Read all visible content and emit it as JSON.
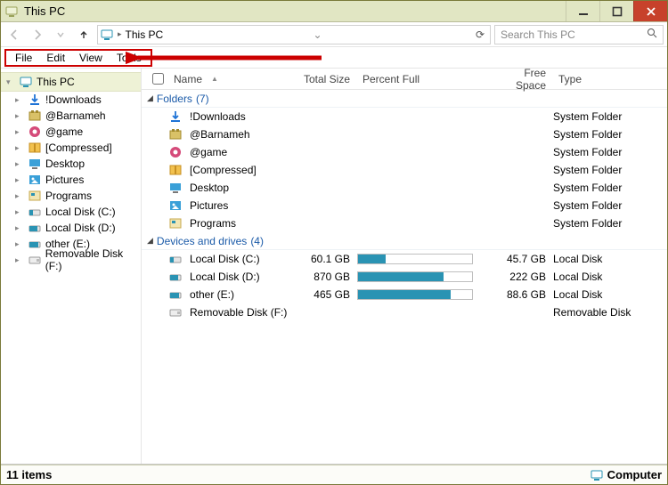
{
  "window": {
    "title": "This PC"
  },
  "address": {
    "crumb": "This PC"
  },
  "search": {
    "placeholder": "Search This PC"
  },
  "menu": {
    "file": "File",
    "edit": "Edit",
    "view": "View",
    "tools": "Tools"
  },
  "sidebar": {
    "root": "This PC",
    "items": [
      {
        "label": "!Downloads"
      },
      {
        "label": "@Barnameh"
      },
      {
        "label": "@game"
      },
      {
        "label": "[Compressed]"
      },
      {
        "label": "Desktop"
      },
      {
        "label": "Pictures"
      },
      {
        "label": "Programs"
      },
      {
        "label": "Local Disk (C:)"
      },
      {
        "label": "Local Disk (D:)"
      },
      {
        "label": "other (E:)"
      },
      {
        "label": "Removable Disk (F:)"
      }
    ]
  },
  "columns": {
    "name": "Name",
    "total": "Total Size",
    "percent": "Percent Full",
    "free": "Free Space",
    "type": "Type"
  },
  "groups": {
    "folders": {
      "label": "Folders",
      "count": "(7)"
    },
    "drives": {
      "label": "Devices and drives",
      "count": "(4)"
    }
  },
  "folders": [
    {
      "name": "!Downloads",
      "type": "System Folder"
    },
    {
      "name": "@Barnameh",
      "type": "System Folder"
    },
    {
      "name": "@game",
      "type": "System Folder"
    },
    {
      "name": "[Compressed]",
      "type": "System Folder"
    },
    {
      "name": "Desktop",
      "type": "System Folder"
    },
    {
      "name": "Pictures",
      "type": "System Folder"
    },
    {
      "name": "Programs",
      "type": "System Folder"
    }
  ],
  "drives": [
    {
      "name": "Local Disk (C:)",
      "total": "60.1 GB",
      "pct": 24,
      "free": "45.7 GB",
      "type": "Local Disk"
    },
    {
      "name": "Local Disk (D:)",
      "total": "870 GB",
      "pct": 75,
      "free": "222 GB",
      "type": "Local Disk"
    },
    {
      "name": "other (E:)",
      "total": "465 GB",
      "pct": 81,
      "free": "88.6 GB",
      "type": "Local Disk"
    },
    {
      "name": "Removable Disk (F:)",
      "total": "",
      "pct": null,
      "free": "",
      "type": "Removable Disk"
    }
  ],
  "status": {
    "items": "11 items",
    "category": "Computer"
  },
  "colors": {
    "accent": "#2a93b3"
  }
}
